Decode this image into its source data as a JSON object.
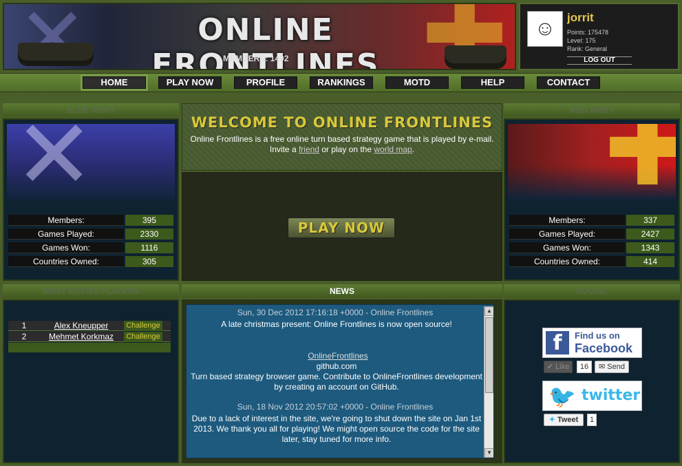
{
  "header": {
    "title": "ONLINE FRONTLINES",
    "members_label": "MEMBERS: 1492"
  },
  "user": {
    "name": "jorrit",
    "points": "Points: 175478",
    "level": "Level: 175",
    "rank": "Rank: General",
    "logout_label": "LOG OUT"
  },
  "nav": {
    "items": [
      {
        "label": "HOME"
      },
      {
        "label": "PLAY NOW"
      },
      {
        "label": "PROFILE"
      },
      {
        "label": "RANKINGS"
      },
      {
        "label": "MOTD"
      },
      {
        "label": "HELP"
      },
      {
        "label": "CONTACT"
      }
    ]
  },
  "blue_army": {
    "title": "BLUE ARMY",
    "stats": [
      {
        "label": "Members:",
        "value": "395"
      },
      {
        "label": "Games Played:",
        "value": "2330"
      },
      {
        "label": "Games Won:",
        "value": "1116"
      },
      {
        "label": "Countries Owned:",
        "value": "305"
      }
    ]
  },
  "red_army": {
    "title": "RED ARMY",
    "stats": [
      {
        "label": "Members:",
        "value": "337"
      },
      {
        "label": "Games Played:",
        "value": "2427"
      },
      {
        "label": "Games Won:",
        "value": "1343"
      },
      {
        "label": "Countries Owned:",
        "value": "414"
      }
    ]
  },
  "welcome": {
    "title": "WELCOME TO ONLINE FRONTLINES",
    "text_part1": "Online Frontlines is a free online turn based strategy game that is played by e-mail. Invite a ",
    "link1": "friend",
    "text_part2": " or play on the ",
    "link2": "world map",
    "text_part3": ".",
    "play_button": "PLAY NOW"
  },
  "active_players": {
    "title": "MOST ACTIVE PLAYERS",
    "rows": [
      {
        "rank": "1",
        "name": "Alex Kneupper",
        "action": "Challenge"
      },
      {
        "rank": "2",
        "name": "Mehmet Korkmaz",
        "action": "Challenge"
      }
    ]
  },
  "news": {
    "title": "NEWS",
    "items": [
      {
        "header": "Sun, 30 Dec 2012 17:16:18 +0000 - Online Frontlines",
        "body": "A late christmas present: Online Frontlines is now open source!"
      },
      {
        "link": "OnlineFrontlines",
        "domain": "github.com",
        "body": "Turn based strategy browser game. Contribute to OnlineFrontlines development by creating an account on GitHub."
      },
      {
        "header": "Sun, 18 Nov 2012 20:57:02 +0000 - Online Frontlines",
        "body": "Due to a lack of interest in the site, we're going to shut down the site on Jan 1st 2013. We thank you all for playing! We might open source the code for the site later, stay tuned for more info."
      }
    ]
  },
  "social": {
    "title": "SOCIAL",
    "facebook_line1": "Find us on",
    "facebook_line2": "Facebook",
    "like_label": "Like",
    "like_count": "16",
    "send_label": "Send",
    "twitter_label": "twitter",
    "tweet_label": "Tweet",
    "tweet_count": "1"
  },
  "colors": {
    "accent_gold": "#d8c83a",
    "panel_blue": "#0f2230",
    "frame_green": "#4a5e2a"
  }
}
